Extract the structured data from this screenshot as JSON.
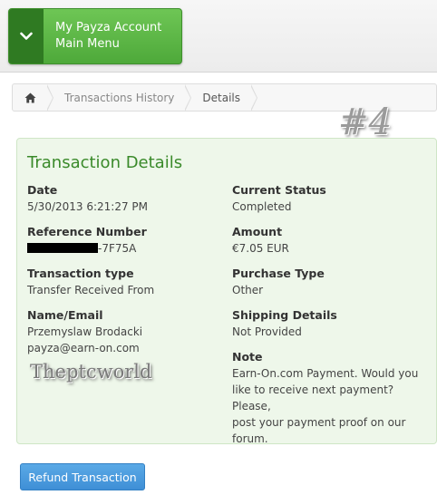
{
  "menu": {
    "line1": "My Payza Account",
    "line2": "Main Menu"
  },
  "breadcrumb": {
    "home_icon": "home-icon",
    "items": [
      "Transactions History",
      "Details"
    ]
  },
  "watermark_number": "#4",
  "details": {
    "title": "Transaction Details",
    "date": {
      "label": "Date",
      "value": "5/30/2013 6:21:27 PM"
    },
    "status": {
      "label": "Current Status",
      "value": "Completed"
    },
    "reference": {
      "label": "Reference Number",
      "value_suffix": "-7F75A"
    },
    "amount": {
      "label": "Amount",
      "value": "€7.05 EUR"
    },
    "type": {
      "label": "Transaction type",
      "value": "Transfer Received From"
    },
    "purchase": {
      "label": "Purchase Type",
      "value": "Other"
    },
    "name_email": {
      "label": "Name/Email",
      "name": "Przemyslaw Brodacki",
      "email": "payza@earn-on.com"
    },
    "shipping": {
      "label": "Shipping Details",
      "value": "Not Provided"
    },
    "note": {
      "label": "Note",
      "lines": [
        "Earn-On.com Payment. Would you",
        "like to receive next payment? Please,",
        "post your payment proof on our",
        "forum."
      ]
    }
  },
  "signature": "Theptcworld",
  "refund_button": "Refund Transaction"
}
